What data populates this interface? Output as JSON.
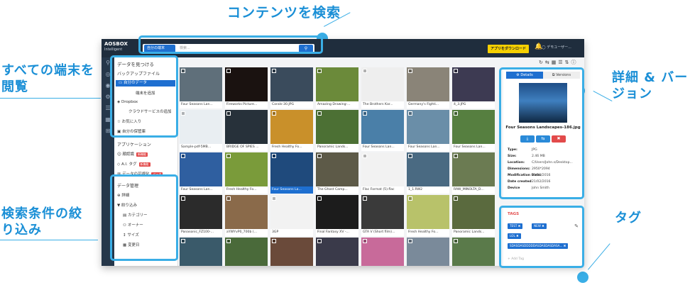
{
  "callouts": {
    "search": "コンテンツを検索",
    "devices": "すべての端末を閲覧",
    "filter": "検索条件の絞り込み",
    "details": "詳細 & バージョン",
    "tags": "タグ"
  },
  "app": {
    "logo": "AOSBOX",
    "logo_sub": "Intelligent",
    "device_select": "自分の端末",
    "search_placeholder": "検索...",
    "download_button": "アプリをダウンロード",
    "user_label": "デモユーザー..."
  },
  "sidebar": {
    "find_heading": "データを見つける",
    "backup_files": "バックアップファイル",
    "my_data": "自分のデータ",
    "add_device": "端末を追加",
    "dropbox": "Dropbox",
    "add_cloud": "クラウドサービスの追加",
    "favorites": "お気に入り",
    "my_storage": "自分の保管庫",
    "apps_heading": "アプリケーション",
    "face_recognition": "顔認識",
    "ai_tags": "A.I. タグ",
    "visualization": "データの可視化",
    "badge_new": "新機能",
    "badge_beta": "ベータ",
    "manage_heading": "データ管理",
    "detail": "詳細",
    "narrow": "絞り込み",
    "category": "カテゴリー",
    "owner": "オーナー",
    "size": "サイズ",
    "modified": "変更日"
  },
  "colors": {
    "accent": "#3aaee6",
    "primary": "#1e6fd0",
    "topbar": "#1f2d3d",
    "highlight": "#f6d000",
    "danger": "#e24a4a"
  },
  "grid": [
    {
      "caption": "Four Seasons Lan...",
      "color": "#5f6f7a"
    },
    {
      "caption": "Fireworks Picture...",
      "color": "#1a1210"
    },
    {
      "caption": "Corals-30.JPG",
      "color": "#3a4b5c"
    },
    {
      "caption": "Amazing Drawing-...",
      "color": "#6b8a3a"
    },
    {
      "caption": "The Brothers Kar...",
      "color": "#eeeeee"
    },
    {
      "caption": "Germany's Fighti...",
      "color": "#8a8478"
    },
    {
      "caption": "4_3.JPG",
      "color": "#3d3a52"
    },
    {
      "caption": "Sample-pdf-5MB...",
      "color": "#e9eef2"
    },
    {
      "caption": "BRIDGE OF SPIES ...",
      "color": "#27313a"
    },
    {
      "caption": "Fresh Healthy Fo...",
      "color": "#c9902a"
    },
    {
      "caption": "Panoramic Lands...",
      "color": "#4c7034"
    },
    {
      "caption": "Four Seasons Lan...",
      "color": "#4a7fa8"
    },
    {
      "caption": "Four Seasons Lan...",
      "color": "#6a8ea8"
    },
    {
      "caption": "Four Seasons Lan...",
      "color": "#567f40"
    },
    {
      "caption": "Four Seasons Lan...",
      "color": "#2f5fa0"
    },
    {
      "caption": "Fresh Healthy Fo...",
      "color": "#7a9b3a"
    },
    {
      "caption": "Four Seasons La...",
      "color": "#1f4a7c",
      "selected": true
    },
    {
      "caption": "The Ghost Camp...",
      "color": "#5d5a48"
    },
    {
      "caption": "Flac Format (5).flac",
      "color": "#f2f2f2"
    },
    {
      "caption": "1_1.RW2",
      "color": "#4a6a82"
    },
    {
      "caption": "RAW_MINOLTA_D...",
      "color": "#6b7b52"
    },
    {
      "caption": "Panasonic_FZ100-...",
      "color": "#2b2b2b"
    },
    {
      "caption": "aYWYvP0_700b (...",
      "color": "#8a6a4a"
    },
    {
      "caption": "3GP",
      "color": "#f2f2f2"
    },
    {
      "caption": "Final Fantasy XV -...",
      "color": "#1c1c1c"
    },
    {
      "caption": "GTA V (Short film)...",
      "color": "#3a3a3a"
    },
    {
      "caption": "Fresh Healthy Fo...",
      "color": "#b8c26a"
    },
    {
      "caption": "Panoramic Lands...",
      "color": "#5a6a3e"
    },
    {
      "caption": "",
      "color": "#3a5a6a"
    },
    {
      "caption": "",
      "color": "#4a6a3a"
    },
    {
      "caption": "",
      "color": "#6a4a3a"
    },
    {
      "caption": "",
      "color": "#3a3a4a"
    },
    {
      "caption": "",
      "color": "#c86a9a"
    },
    {
      "caption": "",
      "color": "#7a8a9a"
    },
    {
      "caption": "",
      "color": "#5a7a4a"
    }
  ],
  "detail": {
    "tab_details": "Details",
    "tab_versions": "Versions",
    "filename": "Four Seasons Landscapes-186.jpg",
    "type_label": "Type:",
    "type": "JPG",
    "size_label": "Size:",
    "size": "2.46 MB",
    "location_label": "Location:",
    "location": "C/Users/John.s/Desktop...",
    "dimensions_label": "Dimensions:",
    "dimensions": "2950*2094",
    "modified_label": "Modification Date:",
    "modified": "21/02/2016",
    "created_label": "Date created",
    "created": "21/02/2016",
    "device_label": "Device",
    "device": "John Smith"
  },
  "tags": {
    "title": "TAGS",
    "items": [
      "TEST",
      "NEW",
      "LOL",
      "SDASDASDDDDDASDASDASDASA..."
    ],
    "add_placeholder": "+ Add Tag"
  }
}
